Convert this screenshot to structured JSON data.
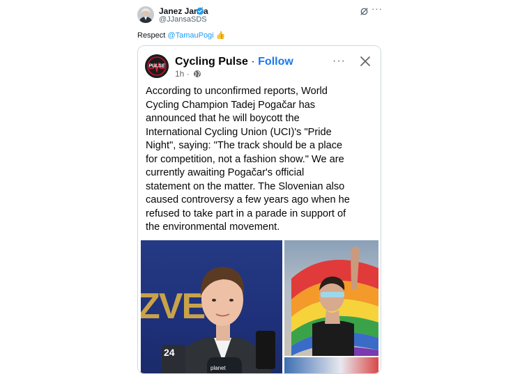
{
  "author": {
    "name": "Janez Janša",
    "handle": "@JJansaSDS",
    "verified": true
  },
  "icons": {
    "grok": "grok-icon",
    "more": "more-icon",
    "verified": "verified-badge-icon"
  },
  "tweet": {
    "text_prefix": "Respect ",
    "mention": "@TamauPogi",
    "emoji": "👍"
  },
  "embedded_post": {
    "page_name": "Cycling Pulse",
    "separator": "·",
    "follow_label": "Follow",
    "timestamp": "1h",
    "meta_sep": "·",
    "logo_text": "PULSE",
    "body_lines": [
      "According to unconfirmed reports, World",
      "Cycling Champion Tadej Pogačar has",
      "announced that he will boycott the",
      "International Cycling Union (UCI)'s \"Pride",
      "Night\", saying: \"The track should be a place",
      "for competition, not a fashion show.\" We are",
      "currently awaiting Pogačar's official",
      "statement on the matter. The Slovenian also",
      "caused controversy a few years ago when he",
      "refused to take part in a parade in support of",
      "the environmental movement."
    ],
    "photo_left_text": "ZVE",
    "photo_left_mic_text": "planet",
    "photo_left_badge": "24"
  },
  "colors": {
    "link": "#1d9bf0",
    "facebook_blue": "#1877f2",
    "verified": "#1d9bf0"
  }
}
